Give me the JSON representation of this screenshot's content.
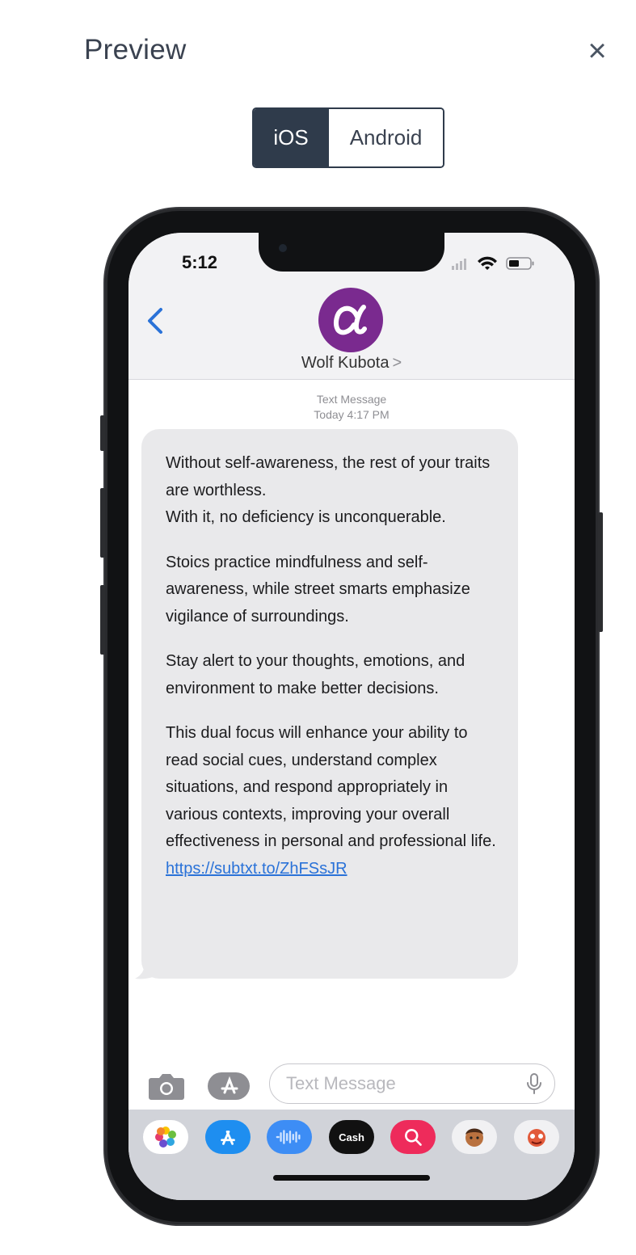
{
  "modal": {
    "title": "Preview",
    "close_icon": "×"
  },
  "platform_toggle": {
    "options": [
      "iOS",
      "Android"
    ],
    "selected": "iOS"
  },
  "phone": {
    "status_bar": {
      "time": "5:12"
    },
    "conversation": {
      "contact_name": "Wolf Kubota",
      "contact_chevron": ">",
      "meta_line1": "Text Message",
      "meta_line2": "Today 4:17 PM"
    },
    "message": {
      "p1_line1": "Without self-awareness, the rest of your traits are worthless.",
      "p1_line2": "With it, no deficiency is unconquerable.",
      "p2": "Stoics practice mindfulness and self-awareness, while street smarts emphasize vigilance of surroundings.",
      "p3": "Stay alert to your thoughts, emotions, and environment to make better decisions.",
      "p4": "This dual focus will enhance your ability to read social cues, understand complex situations, and respond appropriately in various contexts, improving your overall effectiveness in personal and professional life.",
      "link": "https://subtxt.to/ZhFSsJR"
    },
    "composer": {
      "placeholder": "Text Message"
    },
    "app_tray": {
      "apps": [
        {
          "icon": "photos-icon"
        },
        {
          "icon": "app-store-icon"
        },
        {
          "icon": "audio-message-icon"
        },
        {
          "icon": "apple-cash-icon",
          "label": "Cash"
        },
        {
          "icon": "search-images-icon"
        },
        {
          "icon": "memoji-icon"
        },
        {
          "icon": "animoji-icon"
        }
      ]
    }
  },
  "colors": {
    "accent_dark": "#2f3b4b",
    "avatar_purple": "#7a2a8f",
    "ios_blue": "#2a72d8",
    "bubble_gray": "#e9e9eb"
  }
}
